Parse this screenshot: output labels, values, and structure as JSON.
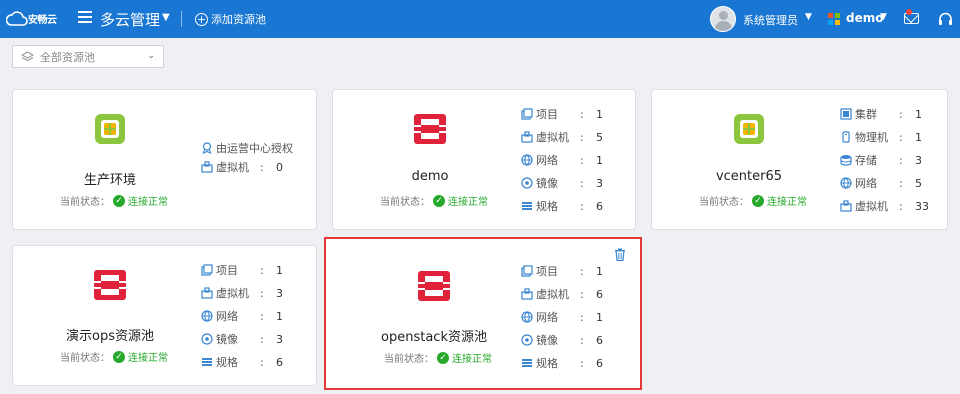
{
  "header": {
    "logo_text": "安畅云",
    "title": "多云管理",
    "add_pool_label": "添加资源池",
    "user_name": "系统管理员",
    "project_name": "demo"
  },
  "filter": {
    "selected": "全部资源池"
  },
  "status": {
    "label": "当前状态：",
    "value": "连接正常"
  },
  "cards": [
    {
      "name": "生产环境",
      "logo": "vmware-logo-icon",
      "stats": [
        {
          "label": "由运营中心授权",
          "icon": "authorized-icon"
        },
        {
          "label": "虚拟机",
          "value": "0",
          "icon": "vm-icon"
        }
      ]
    },
    {
      "name": "demo",
      "logo": "openstack-logo-icon",
      "stats": [
        {
          "label": "项目",
          "value": "1",
          "icon": "project-icon"
        },
        {
          "label": "虚拟机",
          "value": "5",
          "icon": "vm-icon"
        },
        {
          "label": "网络",
          "value": "1",
          "icon": "network-icon"
        },
        {
          "label": "镜像",
          "value": "3",
          "icon": "image-icon"
        },
        {
          "label": "规格",
          "value": "6",
          "icon": "flavor-icon"
        }
      ]
    },
    {
      "name": "vcenter65",
      "logo": "vmware-logo-icon",
      "stats": [
        {
          "label": "集群",
          "value": "1",
          "icon": "cluster-icon"
        },
        {
          "label": "物理机",
          "value": "1",
          "icon": "host-icon"
        },
        {
          "label": "存储",
          "value": "3",
          "icon": "storage-icon"
        },
        {
          "label": "网络",
          "value": "5",
          "icon": "network-icon"
        },
        {
          "label": "虚拟机",
          "value": "33",
          "icon": "vm-icon"
        }
      ]
    },
    {
      "name": "演示ops资源池",
      "logo": "openstack-logo-icon",
      "stats": [
        {
          "label": "项目",
          "value": "1",
          "icon": "project-icon"
        },
        {
          "label": "虚拟机",
          "value": "3",
          "icon": "vm-icon"
        },
        {
          "label": "网络",
          "value": "1",
          "icon": "network-icon"
        },
        {
          "label": "镜像",
          "value": "3",
          "icon": "image-icon"
        },
        {
          "label": "规格",
          "value": "6",
          "icon": "flavor-icon"
        }
      ]
    },
    {
      "name": "openstack资源池",
      "logo": "openstack-logo-icon",
      "stats": [
        {
          "label": "项目",
          "value": "1",
          "icon": "project-icon"
        },
        {
          "label": "虚拟机",
          "value": "6",
          "icon": "vm-icon"
        },
        {
          "label": "网络",
          "value": "1",
          "icon": "network-icon"
        },
        {
          "label": "镜像",
          "value": "6",
          "icon": "image-icon"
        },
        {
          "label": "规格",
          "value": "6",
          "icon": "flavor-icon"
        }
      ]
    }
  ],
  "colors": {
    "header_bg": "#1976d2",
    "status_ok": "#26a92b",
    "openstack_red": "#e0223b",
    "vmware_green": "#8cc63f",
    "vmware_yellow": "#f5b400",
    "highlight_border": "#e53935",
    "stat_icon_blue": "#3a86d0"
  }
}
